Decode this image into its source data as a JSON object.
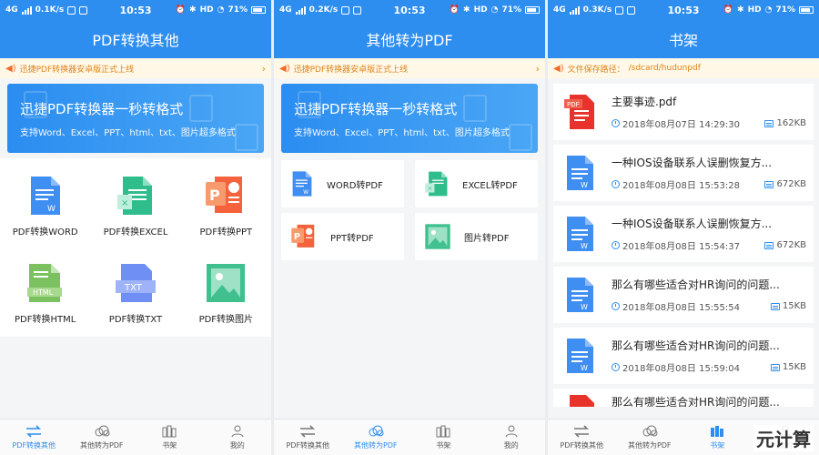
{
  "status": {
    "signal": "4G",
    "time": "10:53",
    "hd": "HD",
    "battery": "71%",
    "speed_s1": "0.1K/s",
    "speed_s2": "0.2K/s",
    "speed_s3": "0.3K/s"
  },
  "screens": {
    "s1": {
      "title": "PDF转换其他",
      "notice": "迅捷PDF转换器安卓版正式上线",
      "banner_title": "迅捷PDF转换器一秒转格式",
      "banner_sub": "支持Word、Excel、PPT、html、txt、图片超多格式",
      "tools": [
        {
          "label": "PDF转换WORD",
          "icon": "word-icon",
          "color": "#3f8ef2"
        },
        {
          "label": "PDF转换EXCEL",
          "icon": "excel-icon",
          "color": "#2fbd8c"
        },
        {
          "label": "PDF转换PPT",
          "icon": "ppt-icon",
          "color": "#f4633b"
        },
        {
          "label": "PDF转换HTML",
          "icon": "html-icon",
          "color": "#7cc160"
        },
        {
          "label": "PDF转换TXT",
          "icon": "txt-icon",
          "color": "#6f8ff5"
        },
        {
          "label": "PDF转换图片",
          "icon": "image-icon",
          "color": "#3fc08e"
        }
      ]
    },
    "s2": {
      "title": "其他转为PDF",
      "notice": "迅捷PDF转换器安卓版正式上线",
      "banner_title": "迅捷PDF转换器一秒转格式",
      "banner_sub": "支持Word、Excel、PPT、html、txt、图片超多格式",
      "tools": [
        {
          "label": "WORD转PDF",
          "icon": "word-icon",
          "color": "#3f8ef2"
        },
        {
          "label": "EXCEL转PDF",
          "icon": "excel-icon",
          "color": "#2fbd8c"
        },
        {
          "label": "PPT转PDF",
          "icon": "ppt-icon",
          "color": "#f4633b"
        },
        {
          "label": "图片转PDF",
          "icon": "image-icon",
          "color": "#3fc08e"
        }
      ]
    },
    "s3": {
      "title": "书架",
      "notice_label": "文件保存路径：",
      "notice_path": "/sdcard/hudunpdf",
      "files": [
        {
          "name": "主要事迹.pdf",
          "date": "2018年08月07日 14:29:30",
          "size": "162KB",
          "icon": "pdf-file-icon"
        },
        {
          "name": "一种IOS设备联系人误删恢复方...",
          "date": "2018年08月08日 15:53:28",
          "size": "672KB",
          "icon": "word-file-icon"
        },
        {
          "name": "一种IOS设备联系人误删恢复方...",
          "date": "2018年08月08日 15:54:37",
          "size": "672KB",
          "icon": "word-file-icon"
        },
        {
          "name": "那么有哪些适合对HR询问的问题...",
          "date": "2018年08月08日 15:55:54",
          "size": "15KB",
          "icon": "word-file-icon"
        },
        {
          "name": "那么有哪些适合对HR询问的问题...",
          "date": "2018年08月08日 15:59:04",
          "size": "15KB",
          "icon": "word-file-icon"
        },
        {
          "name": "那么有哪些适合对HR询问的问题...",
          "date": "",
          "size": "",
          "icon": "pdf-file-icon"
        }
      ]
    }
  },
  "tabs": [
    {
      "label": "PDF转换其他",
      "icon": "convert-arrows-icon"
    },
    {
      "label": "其他转为PDF",
      "icon": "cloud-icon"
    },
    {
      "label": "书架",
      "icon": "bookshelf-icon"
    },
    {
      "label": "我的",
      "icon": "user-icon"
    }
  ],
  "watermark": "元计算",
  "colors": {
    "primary": "#2d8ef0",
    "notice_bg": "#fff8e6",
    "notice_text": "#e0841c"
  }
}
